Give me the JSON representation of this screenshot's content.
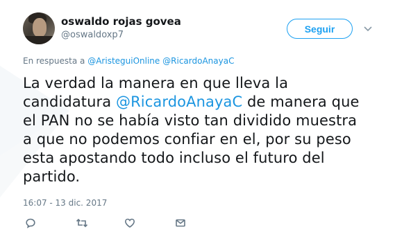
{
  "user": {
    "name": "oswaldo rojas govea",
    "handle": "@oswaldoxp7"
  },
  "follow_button": {
    "label": "Seguir"
  },
  "reply_context": {
    "prefix": "En respuesta a",
    "mentions": [
      "@AristeguiOnline",
      "@RicardoAnayaC"
    ]
  },
  "tweet": {
    "line1": "La verdad la manera en que lleva la",
    "line2_before": "candidatura ",
    "line2_mention": "@RicardoAnayaC",
    "line2_after": " de manera que",
    "line3": "el PAN no se había visto tan dividido muestra",
    "line4": "a que no podemos confiar en el, por su peso",
    "line5": "esta apostando todo incluso el futuro del",
    "line6": "partido."
  },
  "timestamp": "16:07 - 13 dic. 2017",
  "actions": [
    "reply-icon",
    "retweet-icon",
    "like-icon",
    "message-icon"
  ],
  "colors": {
    "link": "#1b95e0",
    "button": "#1da1f2",
    "muted": "#657786",
    "text": "#14171a"
  }
}
